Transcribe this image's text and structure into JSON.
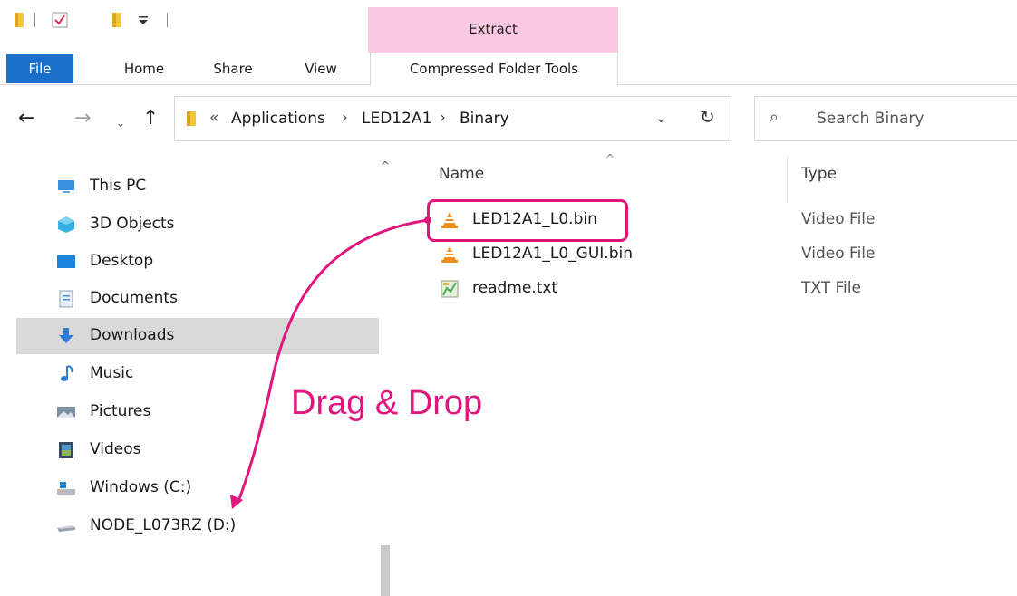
{
  "ribbon": {
    "tabs": [
      "File",
      "Home",
      "Share",
      "View"
    ],
    "contextual_group": "Extract",
    "contextual_tab": "Compressed Folder Tools"
  },
  "address": {
    "overflow": "«",
    "crumbs": [
      "Applications",
      "LED12A1",
      "Binary"
    ],
    "separator": "›",
    "search_placeholder": "Search Binary"
  },
  "nav_pane": {
    "items": [
      {
        "label": "This PC",
        "icon": "this-pc-icon"
      },
      {
        "label": "3D Objects",
        "icon": "3d-objects-icon"
      },
      {
        "label": "Desktop",
        "icon": "desktop-icon"
      },
      {
        "label": "Documents",
        "icon": "documents-icon"
      },
      {
        "label": "Downloads",
        "icon": "downloads-icon",
        "selected": true
      },
      {
        "label": "Music",
        "icon": "music-icon"
      },
      {
        "label": "Pictures",
        "icon": "pictures-icon"
      },
      {
        "label": "Videos",
        "icon": "videos-icon"
      },
      {
        "label": "Windows (C:)",
        "icon": "windows-drive-icon"
      },
      {
        "label": "NODE_L073RZ (D:)",
        "icon": "usb-drive-icon"
      }
    ]
  },
  "file_list": {
    "columns": [
      "Name",
      "Type"
    ],
    "files": [
      {
        "name": "LED12A1_L0.bin",
        "type": "Video File",
        "icon": "vlc-icon"
      },
      {
        "name": "LED12A1_L0_GUI.bin",
        "type": "Video File",
        "icon": "vlc-icon"
      },
      {
        "name": "readme.txt",
        "type": "TXT File",
        "icon": "text-file-icon"
      }
    ]
  },
  "annotation": {
    "text": "Drag & Drop",
    "color": "#e0157d"
  },
  "colors": {
    "file_tab": "#1a6fc9",
    "contextual_header": "#f9c8e2",
    "selected_nav": "#d9d9d9"
  }
}
